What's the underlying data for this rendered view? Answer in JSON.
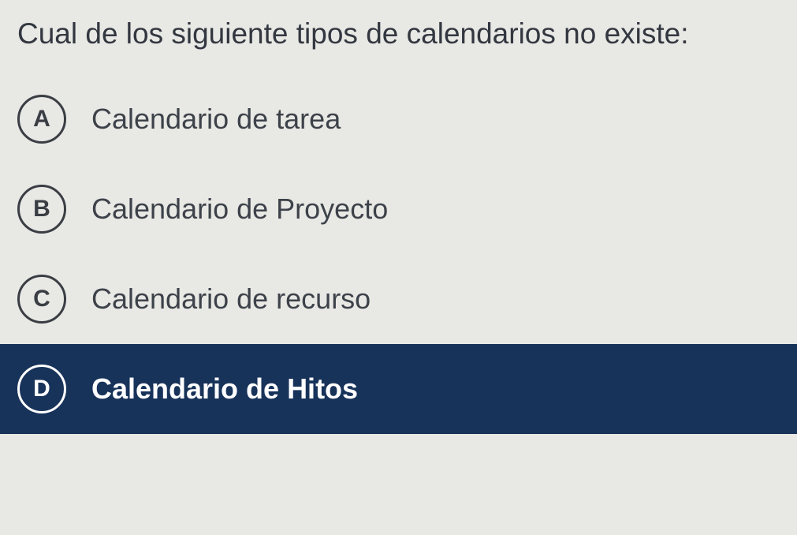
{
  "question": "Cual de los siguiente tipos de calendarios no existe:",
  "options": {
    "a": {
      "letter": "A",
      "text": "Calendario de tarea"
    },
    "b": {
      "letter": "B",
      "text": "Calendario de Proyecto"
    },
    "c": {
      "letter": "C",
      "text": "Calendario de recurso"
    },
    "d": {
      "letter": "D",
      "text": "Calendario de Hitos"
    }
  }
}
